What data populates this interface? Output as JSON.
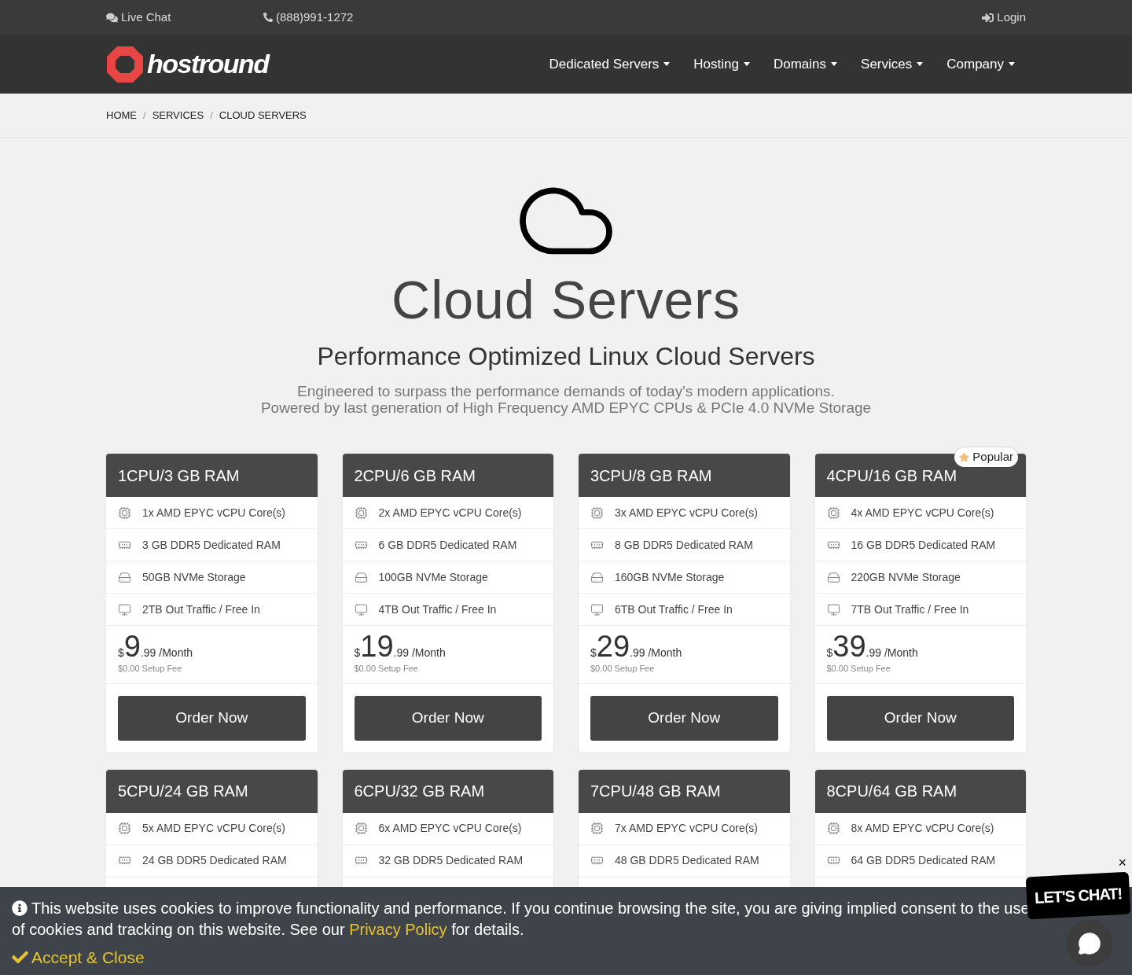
{
  "top_bar": {
    "live_chat": "Live Chat",
    "phone": "(888)991-1272",
    "login": "Login"
  },
  "header": {
    "logo": "hostround",
    "menu": [
      "Dedicated Servers",
      "Hosting",
      "Domains",
      "Services",
      "Company"
    ]
  },
  "breadcrumb": {
    "separator": "/",
    "items": [
      "HOME",
      "SERVICES",
      "CLOUD SERVERS"
    ]
  },
  "hero": {
    "title": "Cloud Servers",
    "subtitle": "Performance Optimized Linux Cloud Servers",
    "description": [
      "Engineered to surpass the performance demands of today's modern applications.",
      "Powered by last generation of High Frequency AMD EPYC CPUs & PCIe 4.0 NVMe Storage"
    ]
  },
  "plans": [
    {
      "title": "1CPU/3 GB RAM",
      "features": [
        {
          "kind": "cpu",
          "text": "1x AMD EPYC vCPU Core(s)"
        },
        {
          "kind": "ram",
          "text": "3 GB DDR5 Dedicated RAM"
        },
        {
          "kind": "storage",
          "text": "50GB NVMe Storage"
        },
        {
          "kind": "traffic",
          "text": "2TB Out Traffic / Free In"
        }
      ],
      "price": {
        "currency": "$",
        "whole": "9",
        "cents": ".99",
        "period": "/Month"
      },
      "setup_fee": "$0.00 Setup Fee",
      "button": "Order Now"
    },
    {
      "title": "2CPU/6 GB RAM",
      "features": [
        {
          "kind": "cpu",
          "text": "2x AMD EPYC vCPU Core(s)"
        },
        {
          "kind": "ram",
          "text": "6 GB DDR5 Dedicated RAM"
        },
        {
          "kind": "storage",
          "text": "100GB NVMe Storage"
        },
        {
          "kind": "traffic",
          "text": "4TB Out Traffic / Free In"
        }
      ],
      "price": {
        "currency": "$",
        "whole": "19",
        "cents": ".99",
        "period": "/Month"
      },
      "setup_fee": "$0.00 Setup Fee",
      "button": "Order Now"
    },
    {
      "title": "3CPU/8 GB RAM",
      "features": [
        {
          "kind": "cpu",
          "text": "3x AMD EPYC vCPU Core(s)"
        },
        {
          "kind": "ram",
          "text": "8 GB DDR5 Dedicated RAM"
        },
        {
          "kind": "storage",
          "text": "160GB NVMe Storage"
        },
        {
          "kind": "traffic",
          "text": "6TB Out Traffic / Free In"
        }
      ],
      "price": {
        "currency": "$",
        "whole": "29",
        "cents": ".99",
        "period": "/Month"
      },
      "setup_fee": "$0.00 Setup Fee",
      "button": "Order Now"
    },
    {
      "title": "4CPU/16 GB RAM",
      "badge": "Popular",
      "features": [
        {
          "kind": "cpu",
          "text": "4x AMD EPYC vCPU Core(s)"
        },
        {
          "kind": "ram",
          "text": "16 GB DDR5 Dedicated RAM"
        },
        {
          "kind": "storage",
          "text": "220GB NVMe Storage"
        },
        {
          "kind": "traffic",
          "text": "7TB Out Traffic / Free In"
        }
      ],
      "price": {
        "currency": "$",
        "whole": "39",
        "cents": ".99",
        "period": "/Month"
      },
      "setup_fee": "$0.00 Setup Fee",
      "button": "Order Now"
    },
    {
      "title": "5CPU/24 GB RAM",
      "features": [
        {
          "kind": "cpu",
          "text": "5x AMD EPYC vCPU Core(s)"
        },
        {
          "kind": "ram",
          "text": "24 GB DDR5 Dedicated RAM"
        }
      ]
    },
    {
      "title": "6CPU/32 GB RAM",
      "features": [
        {
          "kind": "cpu",
          "text": "6x AMD EPYC vCPU Core(s)"
        },
        {
          "kind": "ram",
          "text": "32 GB DDR5 Dedicated RAM"
        }
      ]
    },
    {
      "title": "7CPU/48 GB RAM",
      "features": [
        {
          "kind": "cpu",
          "text": "7x AMD EPYC vCPU Core(s)"
        },
        {
          "kind": "ram",
          "text": "48 GB DDR5 Dedicated RAM"
        }
      ]
    },
    {
      "title": "8CPU/64 GB RAM",
      "features": [
        {
          "kind": "cpu",
          "text": "8x AMD EPYC vCPU Core(s)"
        },
        {
          "kind": "ram",
          "text": "64 GB DDR5 Dedicated RAM"
        }
      ]
    }
  ],
  "cookie_banner": {
    "text_before": "This website uses cookies to improve functionality and performance. If you continue browsing the site, you are giving implied consent to the use of cookies and tracking on this website. See our",
    "link": "Privacy Policy",
    "text_after": "for details.",
    "accept": "Accept & Close"
  },
  "chat_widget": {
    "label": "LET'S CHAT!",
    "close": "×"
  }
}
